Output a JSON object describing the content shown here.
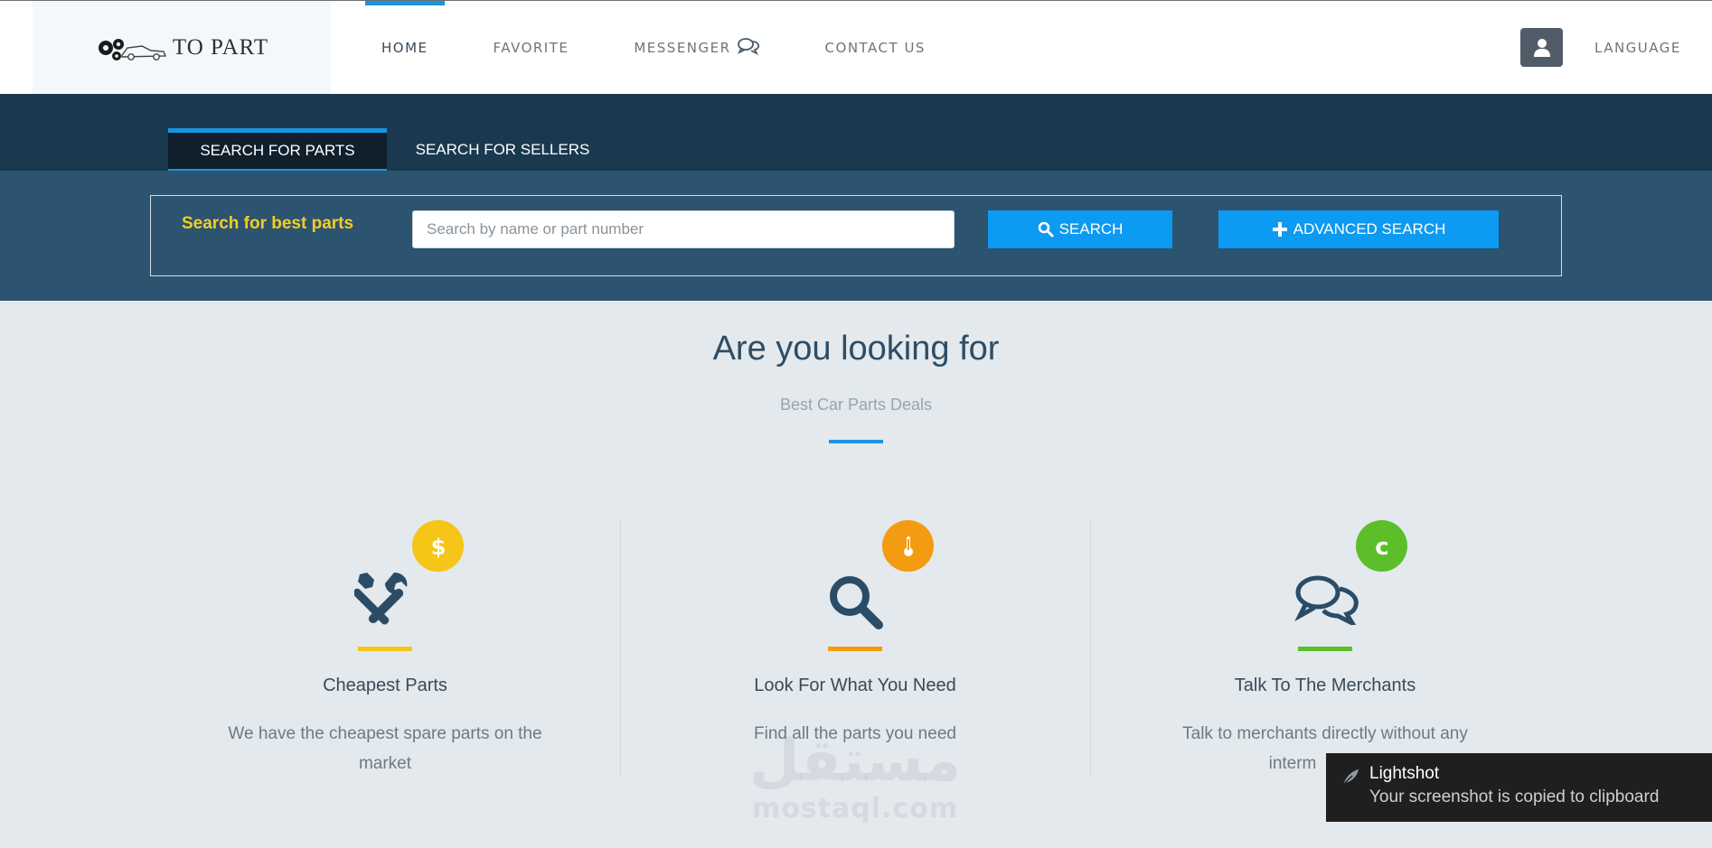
{
  "brand": {
    "logo_text": "TO PART"
  },
  "nav": {
    "items": [
      {
        "label": "HOME"
      },
      {
        "label": "FAVORITE"
      },
      {
        "label": "MESSENGER"
      },
      {
        "label": "CONTACT US"
      }
    ],
    "language_label": "LANGUAGE"
  },
  "tabs": [
    {
      "label": "SEARCH FOR PARTS"
    },
    {
      "label": "SEARCH FOR SELLERS"
    }
  ],
  "search": {
    "label": "Search for best parts",
    "placeholder": "Search by name or part number",
    "value": "",
    "search_button": "SEARCH",
    "advanced_button": "ADVANCED SEARCH"
  },
  "intro": {
    "headline": "Are you looking for",
    "subline": "Best Car Parts Deals"
  },
  "features": [
    {
      "title": "Cheapest Parts",
      "desc_line1": "We have the cheapest spare parts on the",
      "desc_line2": "market",
      "badge": "$",
      "icon": "tools-icon",
      "color": "#f5c518"
    },
    {
      "title": "Look For What You Need",
      "desc_line1": "Find all the parts you need",
      "icon": "search-icon",
      "color": "#f39c12"
    },
    {
      "title": "Talk To The Merchants",
      "desc_line1": "Talk to merchants directly without any",
      "desc_line2": "interm",
      "badge": "c",
      "icon": "chat-icon",
      "color": "#5cbf2a"
    }
  ],
  "watermark": {
    "arabic": "مستقل",
    "latin": "mostaql.com"
  },
  "toast": {
    "title": "Lightshot",
    "message": "Your screenshot is copied to clipboard"
  },
  "colors": {
    "accent": "#1a94e1",
    "dark_band": "#1a394f",
    "search_band": "#2c5370",
    "label_yellow": "#f5cd21",
    "button_blue": "#0c9af2",
    "icon_navy": "#2e4d66"
  }
}
